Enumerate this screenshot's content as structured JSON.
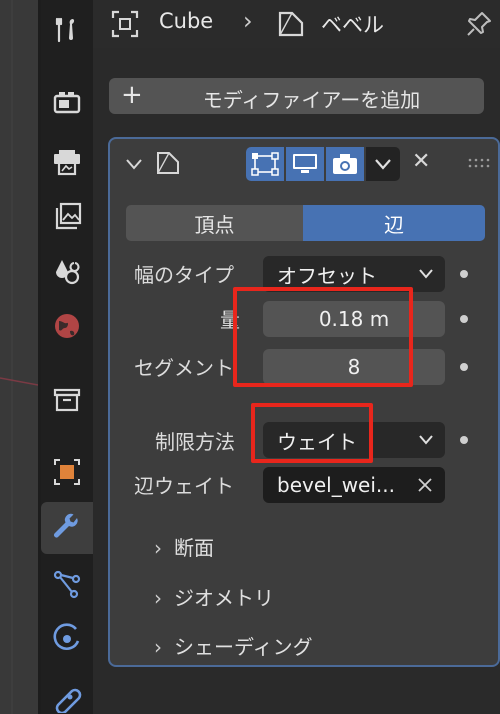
{
  "breadcrumb": {
    "object_name": "Cube",
    "modifier_name": "ベベル"
  },
  "tabs": [
    {
      "name": "tool-icon"
    },
    {
      "name": "render-icon"
    },
    {
      "name": "output-icon"
    },
    {
      "name": "view-layer-icon"
    },
    {
      "name": "scene-icon"
    },
    {
      "name": "world-icon"
    },
    {
      "name": "collection-icon"
    },
    {
      "name": "object-icon"
    },
    {
      "name": "modifier-wrench-icon",
      "active": true
    },
    {
      "name": "particles-icon"
    },
    {
      "name": "physics-icon"
    },
    {
      "name": "constraints-icon"
    }
  ],
  "add_modifier": {
    "plus": "+",
    "label": "モディファイアーを追加"
  },
  "modifier": {
    "affect": {
      "options": [
        "頂点",
        "辺"
      ],
      "selected": "辺"
    },
    "width_type": {
      "label": "幅のタイプ",
      "value": "オフセット"
    },
    "amount": {
      "label": "量",
      "value": "0.18 m"
    },
    "segments": {
      "label": "セグメント",
      "value": "8"
    },
    "limit_method": {
      "label": "制限方法",
      "value": "ウェイト"
    },
    "edge_weight": {
      "label": "辺ウェイト",
      "value": "bevel_wei..."
    },
    "subpanels": [
      "断面",
      "ジオメトリ",
      "シェーディング"
    ],
    "close_glyph": "✕"
  },
  "colors": {
    "accent_blue": "#4772b3",
    "panel_border": "#4b6a98",
    "highlight_red": "#e8261c"
  }
}
